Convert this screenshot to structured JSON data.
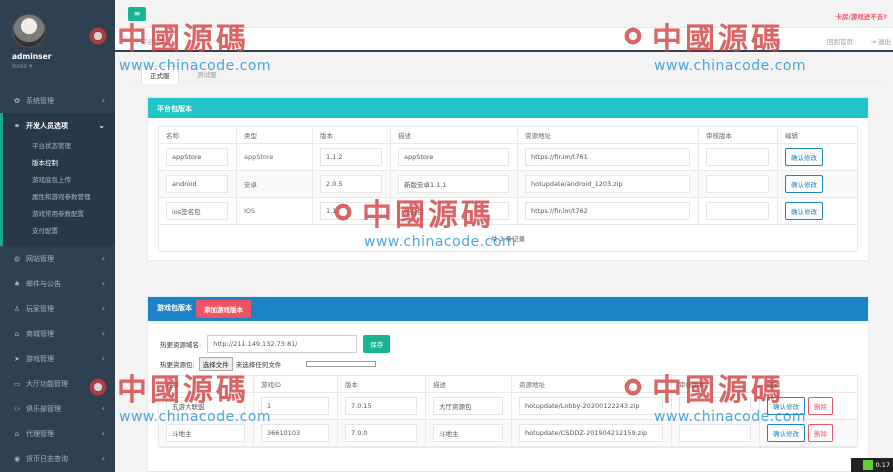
{
  "user": {
    "name": "adminser",
    "role": "boss ▾"
  },
  "nav": {
    "items_top": [
      {
        "label": "系统管理",
        "icon": "gear-icon",
        "glyph": "✿"
      }
    ],
    "active_group": {
      "label": "开发人员选项",
      "icon": "gamepad-icon",
      "glyph": "⚭",
      "children": [
        "平台状态管理",
        "版本控制",
        "游戏底包上传",
        "属性和游戏参数管理",
        "游戏常用参数配置",
        "支付配置"
      ],
      "current": "版本控制"
    },
    "items_bottom": [
      {
        "label": "网站管理",
        "icon": "globe-icon",
        "glyph": "◍"
      },
      {
        "label": "邮件与公告",
        "icon": "bell-icon",
        "glyph": "♠"
      },
      {
        "label": "玩家管理",
        "icon": "user-icon",
        "glyph": "♙"
      },
      {
        "label": "商城管理",
        "icon": "cart-icon",
        "glyph": "⌂"
      },
      {
        "label": "游戏管理",
        "icon": "send-icon",
        "glyph": "➤"
      },
      {
        "label": "大厅功能管理",
        "icon": "desktop-icon",
        "glyph": "▭"
      },
      {
        "label": "俱乐部管理",
        "icon": "group-icon",
        "glyph": "⚇"
      },
      {
        "label": "代理管理",
        "icon": "bank-icon",
        "glyph": "⌂"
      },
      {
        "label": "货币日志查询",
        "icon": "money-icon",
        "glyph": "◉"
      }
    ]
  },
  "topbar": {
    "menu_glyph": "≡",
    "right_link": "卡房/游戏进不去?"
  },
  "tabsbar": {
    "home_tab": "平台控制",
    "refresh": "回到首页",
    "logout": "退出"
  },
  "subtabs": {
    "active": "正式服",
    "inactive": "测试服"
  },
  "platform": {
    "title": "平台包版本",
    "headers": [
      "名称",
      "类型",
      "版本",
      "描述",
      "资源地址",
      "审核版本",
      "编辑"
    ],
    "rows": [
      {
        "name": "appStore",
        "type": "appStore",
        "version": "1.1.2",
        "desc": "appStore",
        "url": "https://fir.im/t761",
        "review": "",
        "btn": "确认修改"
      },
      {
        "name": "android",
        "type": "安卓",
        "version": "2.0.5",
        "desc": "新版安卓1.1.1",
        "url": "hotupdate/android_1203.zip",
        "review": "",
        "btn": "确认修改"
      },
      {
        "name": "ios签名包",
        "type": "IOS",
        "version": "1.1.2",
        "desc": "签名包",
        "url": "https://fir.im/t762",
        "review": "",
        "btn": "确认修改"
      }
    ],
    "footer": "共 3 条记录"
  },
  "game": {
    "title": "游戏包版本",
    "add_btn": "添加游戏版本",
    "host_label": "热更资源域名:",
    "host_value": "http://211.149.132.73:81/",
    "save_btn": "保存",
    "pkg_label": "热更资源包:",
    "file_btn": "选择文件",
    "file_status": "未选择任何文件",
    "headers": [
      "名称",
      "游戏ID",
      "版本",
      "描述",
      "资源地址",
      "审核版本",
      "编辑"
    ],
    "rows": [
      {
        "name": "五游大联盟",
        "id": "1",
        "version": "7.0.15",
        "desc": "大厅资源包",
        "url": "hotupdate/Lobby-20200122243.zip",
        "review": "",
        "btn": "确认修改",
        "del": "删除"
      },
      {
        "name": "斗地主",
        "id": "36610103",
        "version": "7.0.0",
        "desc": "斗地主",
        "url": "hotupdate/CSDDZ-201904212159.zip",
        "review": "",
        "btn": "确认修改",
        "del": "删除"
      }
    ]
  },
  "watermark": {
    "cn": "中國源碼",
    "url": "www.chinacode.com"
  },
  "status": {
    "text": "0.17"
  },
  "colors": {
    "sidebar": "#2f4050",
    "teal": "#23c6c8",
    "blue": "#1c84c6",
    "green": "#1ab394",
    "red": "#ed5565"
  }
}
